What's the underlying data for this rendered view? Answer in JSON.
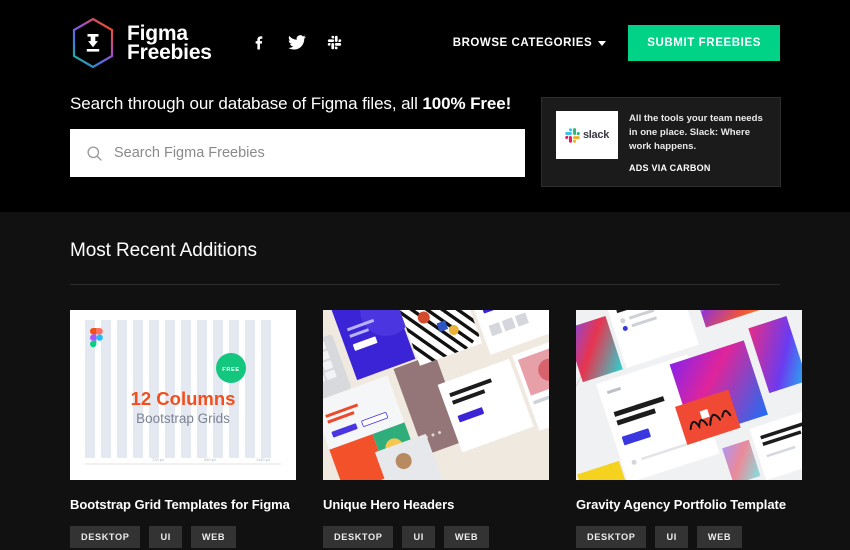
{
  "header": {
    "brand_line1": "Figma",
    "brand_line2": "Freebies",
    "logo_icon": "figma-freebies-hexagon-logo",
    "social": [
      {
        "name": "facebook-icon",
        "label": "Facebook"
      },
      {
        "name": "twitter-icon",
        "label": "Twitter"
      },
      {
        "name": "slack-icon",
        "label": "Slack"
      }
    ],
    "browse_categories": "BROWSE CATEGORIES",
    "submit_button": "SUBMIT FREEBIES",
    "accent_green": "#00d387"
  },
  "hero": {
    "tagline_pre": "Search through our database of Figma files, all ",
    "tagline_bold": "100% Free!",
    "search_placeholder": "Search Figma Freebies",
    "search_value": "",
    "search_icon": "search-icon"
  },
  "ad": {
    "logo_text": "slack",
    "body": "All the tools your team needs in one place. Slack: Where work happens.",
    "via": "ADS VIA CARBON"
  },
  "section": {
    "title": "Most Recent Additions"
  },
  "cards": [
    {
      "title": "Bootstrap Grid Templates for Figma",
      "thumb": "bootstrap-grid-preview",
      "badge": "FREE",
      "thumb_heading": "12 Columns",
      "thumb_sub": "Bootstrap Grids",
      "measure_labels": [
        "720 px",
        "940 px",
        "1140 px"
      ],
      "tags": [
        "DESKTOP",
        "UI",
        "WEB"
      ]
    },
    {
      "title": "Unique Hero Headers",
      "thumb": "hero-headers-preview",
      "tags": [
        "DESKTOP",
        "UI",
        "WEB"
      ]
    },
    {
      "title": "Gravity Agency Portfolio Template",
      "thumb": "gravity-portfolio-preview",
      "tags": [
        "DESKTOP",
        "UI",
        "WEB"
      ]
    }
  ]
}
